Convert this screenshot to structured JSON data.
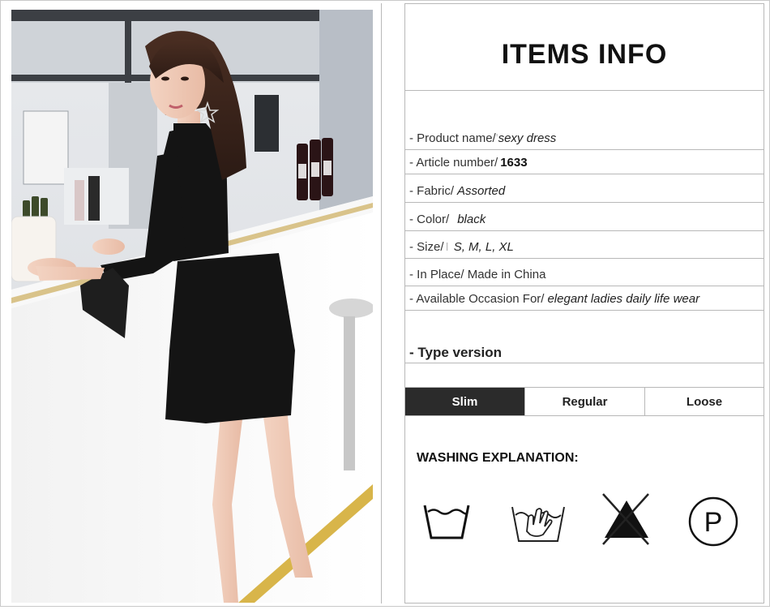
{
  "items_info": {
    "title": "ITEMS INFO",
    "rows": [
      {
        "label": "- Product name/",
        "sep": "'",
        "value": "sexy dress"
      },
      {
        "label": "- Article number/",
        "value": "1633"
      },
      {
        "label": "- Fabric/",
        "value": "Assorted"
      },
      {
        "label": "- Color/",
        "value": "black"
      },
      {
        "label": "- Size/",
        "sep": "I",
        "value": "S, M, L, XL"
      },
      {
        "label": "- In Place/ Made in China",
        "value": ""
      },
      {
        "label": "- Available Occasion For/",
        "value": "elegant ladies daily life wear"
      }
    ],
    "type_label": "- Type version"
  },
  "fit_tabs": [
    {
      "label": "Slim",
      "active": true
    },
    {
      "label": "Regular",
      "active": false
    },
    {
      "label": "Loose",
      "active": false
    }
  ],
  "washing": {
    "title": "WASHING EXPLANATION:",
    "icons": [
      "wash-tub-icon",
      "hand-wash-icon",
      "no-bleach-icon",
      "dry-clean-p-icon"
    ],
    "p_glyph": "P"
  },
  "colors": {
    "active_tab": "#2b2b2b",
    "dress": "#141414"
  }
}
